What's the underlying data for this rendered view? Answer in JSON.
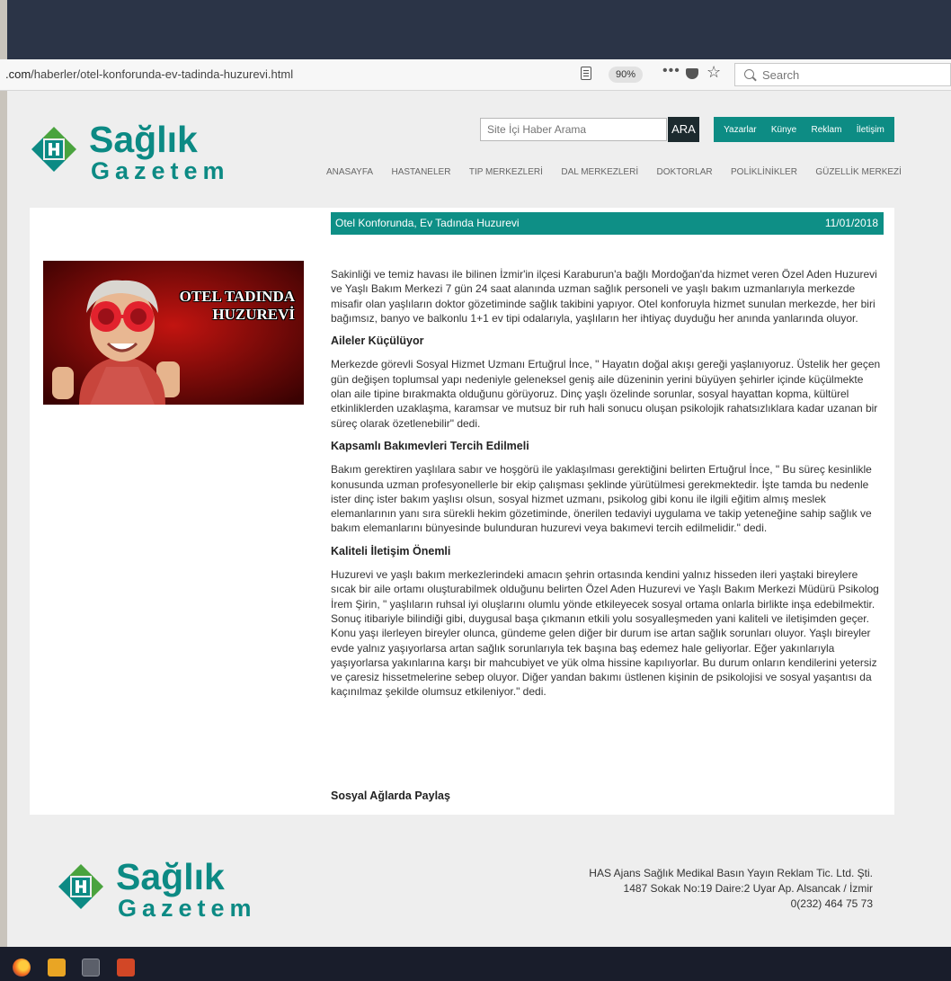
{
  "browser": {
    "url_prefix": ".com",
    "url_path": "/haberler/otel-konforunda-ev-tadinda-huzurevi.html",
    "zoom": "90%",
    "more": "•••",
    "search_placeholder": "Search"
  },
  "header": {
    "logo_word1": "Sağlık",
    "logo_word2": "Gazetem",
    "site_search_placeholder": "Site İçi Haber Arama",
    "search_button": "ARA",
    "top_links": [
      "Yazarlar",
      "Künye",
      "Reklam",
      "İletişim"
    ],
    "nav": [
      "ANASAYFA",
      "HASTANELER",
      "TIP MERKEZLERİ",
      "DAL MERKEZLERİ",
      "DOKTORLAR",
      "POLİKLİNİKLER",
      "GÜZELLİK MERKEZİ"
    ]
  },
  "article": {
    "title": "Otel Konforunda, Ev Tadında Huzurevi",
    "date": "11/01/2018",
    "image_caption_line1": "OTEL TADINDA",
    "image_caption_line2": "HUZUREVİ",
    "intro": "Sakinliği ve temiz havası ile bilinen İzmir'in ilçesi Karaburun'a bağlı Mordoğan'da hizmet veren Özel Aden Huzurevi ve Yaşlı Bakım Merkezi 7 gün 24 saat alanında uzman sağlık personeli ve yaşlı bakım uzmanlarıyla merkezde misafir olan yaşlıların doktor gözetiminde sağlık takibini yapıyor. Otel konforuyla hizmet sunulan merkezde, her biri bağımsız, banyo ve balkonlu 1+1 ev tipi odalarıyla, yaşlıların her ihtiyaç duyduğu her anında yanlarında oluyor.",
    "h1": "Aileler Küçülüyor",
    "p1": "Merkezde görevli Sosyal Hizmet Uzmanı Ertuğrul İnce, \" Hayatın doğal akışı gereği yaşlanıyoruz. Üstelik her geçen gün değişen toplumsal yapı nedeniyle geleneksel geniş aile düzeninin yerini büyüyen şehirler içinde küçülmekte olan aile tipine bırakmakta olduğunu görüyoruz. Dinç yaşlı özelinde sorunlar, sosyal hayattan kopma, kültürel etkinliklerden uzaklaşma, karamsar ve mutsuz bir ruh hali sonucu oluşan psikolojik rahatsızlıklara kadar uzanan bir süreç olarak özetlenebilir\" dedi.",
    "h2": "Kapsamlı Bakımevleri Tercih Edilmeli",
    "p2": "Bakım gerektiren yaşlılara sabır ve hoşgörü ile yaklaşılması gerektiğini belirten Ertuğrul İnce, \"  Bu süreç kesinlikle konusunda uzman profesyonellerle bir ekip çalışması şeklinde yürütülmesi gerekmektedir. İşte tamda bu nedenle ister dinç ister bakım yaşlısı olsun, sosyal hizmet uzmanı, psikolog gibi konu ile ilgili eğitim almış meslek elemanlarının yanı sıra sürekli hekim gözetiminde, önerilen tedaviyi uygulama ve takip yeteneğine sahip sağlık ve bakım elemanlarını bünyesinde bulunduran huzurevi veya bakımevi tercih edilmelidir.\" dedi.",
    "h3": "Kaliteli İletişim Önemli",
    "p3": "Huzurevi ve yaşlı bakım merkezlerindeki amacın şehrin ortasında kendini yalnız hisseden ileri yaştaki bireylere sıcak bir aile ortamı oluşturabilmek olduğunu belirten Özel Aden Huzurevi ve Yaşlı Bakım Merkezi Müdürü Psikolog İrem Şirin, \" yaşlıların ruhsal iyi oluşlarını olumlu yönde etkileyecek sosyal ortama onlarla birlikte inşa edebilmektir. Sonuç itibariyle bilindiği gibi, duygusal başa çıkmanın etkili yolu sosyalleşmeden yani kaliteli ve iletişimden geçer. Konu yaşı ilerleyen bireyler olunca, gündeme gelen diğer bir durum ise artan sağlık sorunları oluyor. Yaşlı bireyler evde yalnız yaşıyorlarsa artan sağlık sorunlarıyla tek başına baş edemez hale geliyorlar. Eğer yakınlarıyla yaşıyorlarsa yakınlarına karşı bir mahcubiyet ve yük olma hissine kapılıyorlar. Bu durum onların kendilerini yetersiz ve çaresiz hissetmelerine sebep oluyor. Diğer yandan bakımı üstlenen kişinin de psikolojisi ve sosyal yaşantısı da kaçınılmaz şekilde olumsuz etkileniyor.\" dedi.",
    "share": "Sosyal Ağlarda Paylaş"
  },
  "footer": {
    "company": "HAS Ajans Sağlık Medikal Basın Yayın Reklam Tic. Ltd. Şti.",
    "address": "1487 Sokak No:19 Daire:2 Uyar Ap. Alsancak / İzmir",
    "phone": "0(232) 464 75 73"
  },
  "colors": {
    "brand": "#0c8a84",
    "teal_bar": "#0e8f86",
    "logo_green": "#4aa33e"
  }
}
